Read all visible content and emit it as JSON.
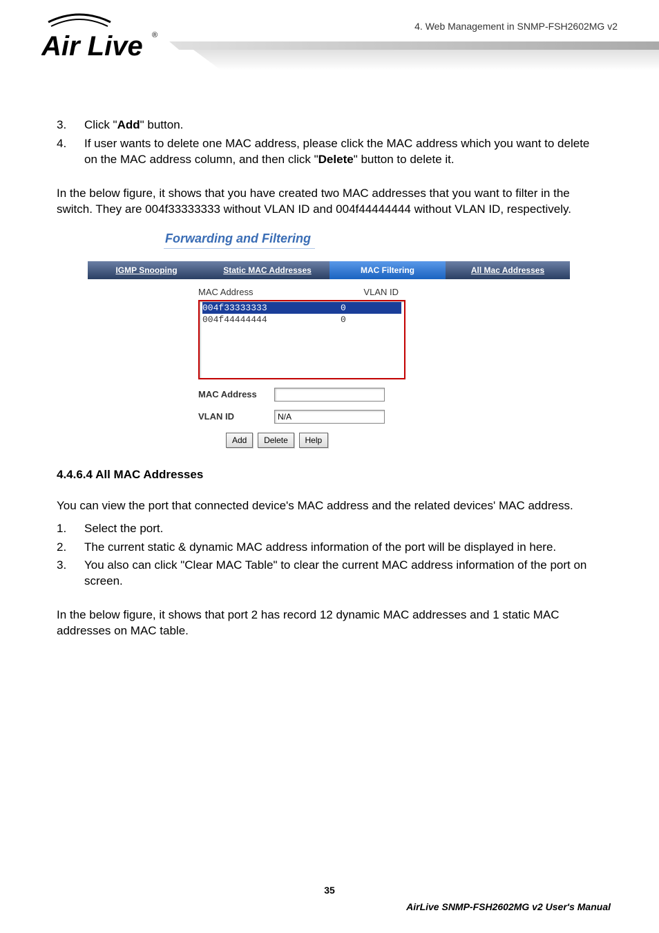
{
  "header": {
    "breadcrumb": "4.  Web  Management  in  SNMP-FSH2602MG  v2",
    "logo_text_top": "Air Live",
    "logo_reg": "®"
  },
  "list1": [
    {
      "n": "3.",
      "pre": "Click \"",
      "bold": "Add",
      "post": "\" button."
    },
    {
      "n": "4.",
      "pre": "If user wants to delete one MAC address, please click the MAC address which you want to delete on the MAC address column, and then click \"",
      "bold": "Delete",
      "post": "\" button to delete it."
    }
  ],
  "para1": "In the below figure, it shows that you have created two MAC addresses that you want to filter in the switch. They are 004f33333333 without VLAN ID and 004f44444444 without VLAN ID, respectively.",
  "figure": {
    "title": "Forwarding and Filtering",
    "tabs": {
      "t1": "IGMP Snooping",
      "t2": "Static MAC Addresses",
      "t3": "MAC Filtering",
      "t4": "All Mac Addresses"
    },
    "hdr": {
      "c1": "MAC Address",
      "c2": "VLAN ID"
    },
    "rows": [
      {
        "mac": "004f33333333",
        "vlan": "0",
        "selected": true
      },
      {
        "mac": "004f44444444",
        "vlan": "0",
        "selected": false
      }
    ],
    "form": {
      "mac_label": "MAC Address",
      "mac_value": "",
      "vlan_label": "VLAN ID",
      "vlan_value": "N/A"
    },
    "buttons": {
      "add": "Add",
      "delete": "Delete",
      "help": "Help"
    }
  },
  "section_title": "4.4.6.4 All MAC Addresses",
  "para2": "You can view the port that connected device's MAC address and the related devices' MAC address.",
  "list2": [
    {
      "n": "1.",
      "text": "Select the port."
    },
    {
      "n": "2.",
      "text": "The current static & dynamic MAC address information of the port will be displayed in here."
    },
    {
      "n": "3.",
      "text": "You also can click \"Clear MAC Table\" to clear the current MAC address information of the port on screen."
    }
  ],
  "para3": "In the below figure, it shows that port 2 has record 12 dynamic MAC addresses and 1 static MAC addresses on MAC table.",
  "page_number": "35",
  "footer": "AirLive  SNMP-FSH2602MG  v2  User's  Manual"
}
